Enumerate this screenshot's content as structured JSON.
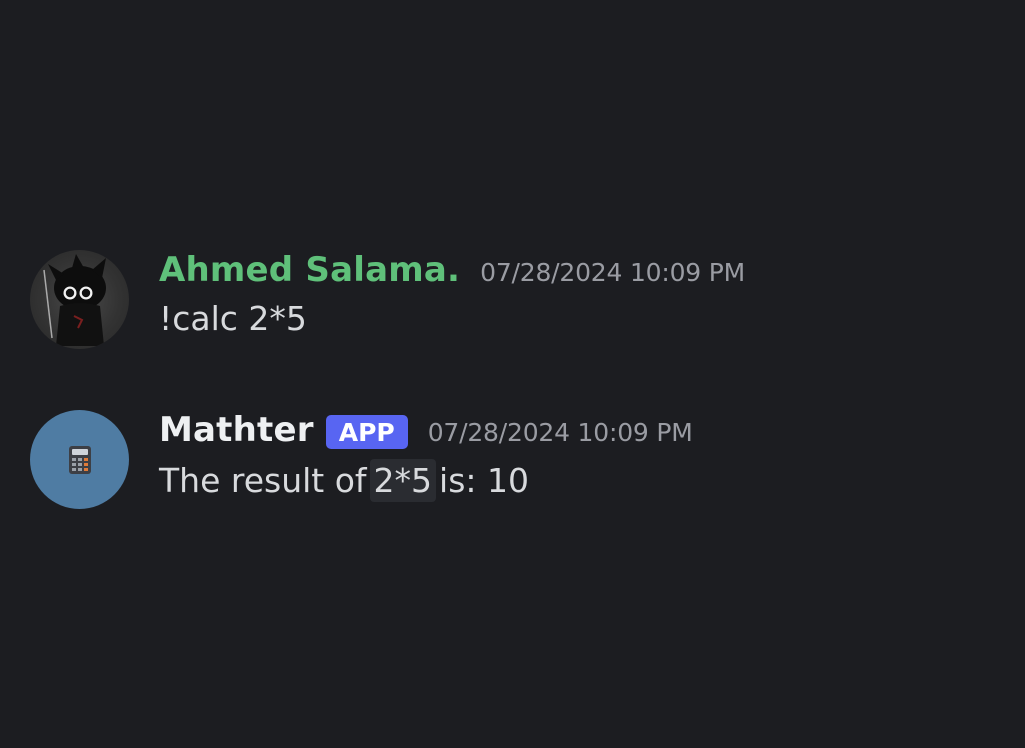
{
  "messages": [
    {
      "username": "Ahmed Salama.",
      "username_color": "#5fc07a",
      "timestamp": "07/28/2024 10:09 PM",
      "text": "!calc 2*5",
      "avatar_icon": "dark-character-avatar"
    },
    {
      "username": "Mathter",
      "username_color": "#eef0f2",
      "badge": "APP",
      "badge_color": "#5865f2",
      "timestamp": "07/28/2024 10:09 PM",
      "text_before": "The result of",
      "code": "2*5",
      "text_after": "is: 10",
      "avatar_icon": "calculator-icon",
      "avatar_color": "#4f7ca3"
    }
  ],
  "colors": {
    "background": "#1c1d21",
    "message_text": "#d8dadd",
    "timestamp": "#9a9ca3"
  }
}
